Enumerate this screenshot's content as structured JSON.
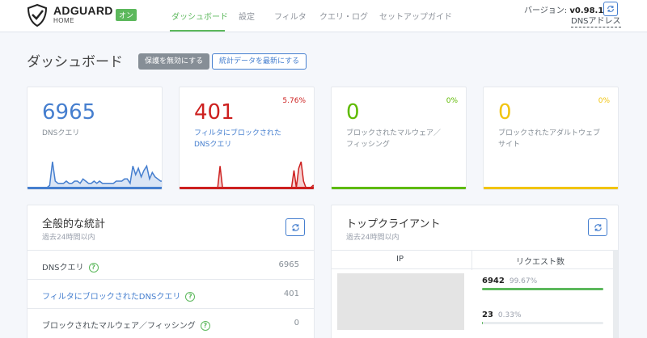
{
  "header": {
    "brand": "ADGUARD",
    "brand_sub": "HOME",
    "status_badge": "オン",
    "nav": [
      {
        "label": "ダッシュボード",
        "active": true
      },
      {
        "label": "設定",
        "active": false
      },
      {
        "label": "フィルタ",
        "active": false
      },
      {
        "label": "クエリ・ログ",
        "active": false
      },
      {
        "label": "セットアップガイド",
        "active": false
      }
    ],
    "version_label": "バージョン: ",
    "version_value": "v0.98.1",
    "dns_addresses_link": "DNSアドレス"
  },
  "page": {
    "title": "ダッシュボード",
    "disable_protection_button": "保護を無効にする",
    "refresh_stats_button": "統計データを最新にする"
  },
  "stat_cards": [
    {
      "value": "6965",
      "label_line1": "DNSクエリ",
      "label_line2": "",
      "percent": "",
      "color": "#467fcf",
      "spark": [
        0,
        0,
        0,
        0,
        0,
        0,
        0,
        0,
        1,
        12,
        3,
        2,
        2,
        2,
        3,
        2,
        2,
        3,
        3,
        2,
        4,
        3,
        2,
        2,
        3,
        2,
        3,
        2,
        2,
        2,
        2,
        2,
        3,
        3,
        3,
        4,
        4,
        2,
        10,
        6,
        9,
        5,
        8,
        10,
        4,
        7,
        5,
        4,
        3,
        3
      ]
    },
    {
      "value": "401",
      "label_line1": "フィルタにブロックされた",
      "label_line2": "DNSクエリ",
      "percent": "5.76%",
      "color": "#cd201f",
      "spark": [
        0,
        0,
        0,
        0,
        0,
        0,
        0,
        0,
        0,
        0,
        0,
        0,
        0,
        0,
        0,
        0,
        0,
        10,
        0,
        0,
        0,
        0,
        0,
        0,
        0,
        0,
        0,
        0,
        0,
        0,
        0,
        0,
        0,
        0,
        0,
        0,
        0,
        0,
        0,
        0,
        0,
        0,
        0,
        0,
        0,
        0,
        0,
        0,
        8,
        0,
        9,
        12,
        3,
        0,
        0,
        0,
        1,
        0
      ]
    },
    {
      "value": "0",
      "label_line1": "ブロックされたマルウェア／",
      "label_line2": "フィッシング",
      "percent": "0%",
      "color": "#5eba00",
      "spark": []
    },
    {
      "value": "0",
      "label_line1": "ブロックされたアダルトウェブ",
      "label_line2": "サイト",
      "percent": "0%",
      "color": "#f1c40f",
      "spark": []
    }
  ],
  "general_stats": {
    "title": "全般的な統計",
    "subtitle": "過去24時間以内",
    "rows": [
      {
        "label": "DNSクエリ",
        "value": "6965",
        "link": false
      },
      {
        "label": "フィルタにブロックされたDNSクエリ",
        "value": "401",
        "link": true
      },
      {
        "label": "ブロックされたマルウェア／フィッシング",
        "value": "0",
        "link": false
      }
    ]
  },
  "top_clients": {
    "title": "トップクライアント",
    "subtitle": "過去24時間以内",
    "columns": [
      "IP",
      "リクエスト数"
    ],
    "rows": [
      {
        "count": "6942",
        "percent": "99.67%",
        "fraction": 0.9967
      },
      {
        "count": "23",
        "percent": "0.33%",
        "fraction": 0.0033
      }
    ]
  },
  "help_icon_glyph": "?",
  "accent_color": "#467fcf",
  "success_color": "#5cb85c"
}
